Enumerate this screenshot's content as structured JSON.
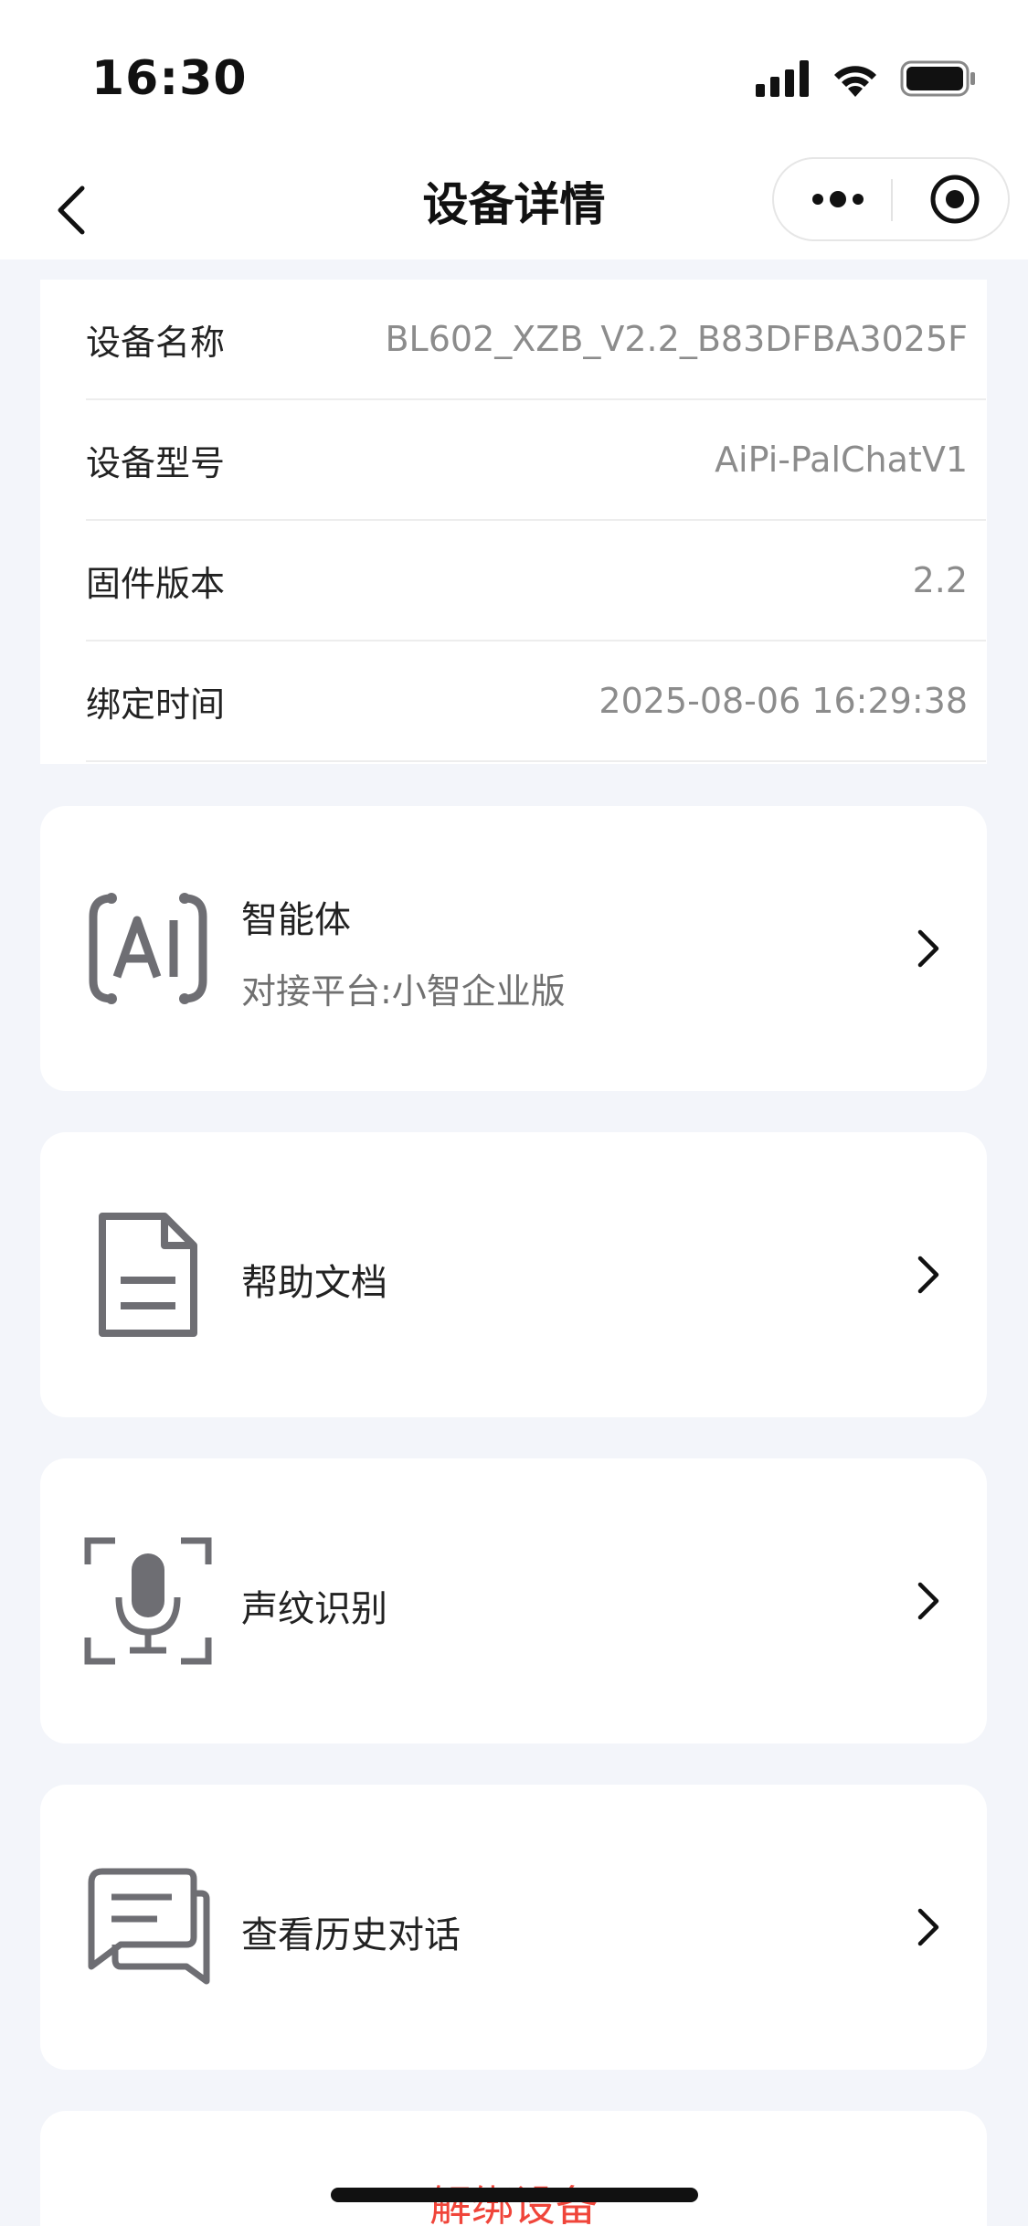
{
  "status_bar": {
    "time": "16:30"
  },
  "nav": {
    "title": "设备详情"
  },
  "device_info": [
    {
      "label": "设备名称",
      "value": "BL602_XZB_V2.2_B83DFBA3025F"
    },
    {
      "label": "设备型号",
      "value": "AiPi-PalChatV1"
    },
    {
      "label": "固件版本",
      "value": "2.2"
    },
    {
      "label": "绑定时间",
      "value": "2025-08-06 16:29:38"
    }
  ],
  "menu": [
    {
      "title": "智能体",
      "subtitle": "对接平台:小智企业版",
      "icon": "ai-agent-icon"
    },
    {
      "title": "帮助文档",
      "icon": "document-icon"
    },
    {
      "title": "声纹识别",
      "icon": "microphone-scan-icon"
    },
    {
      "title": "查看历史对话",
      "icon": "chat-bubbles-icon"
    }
  ],
  "unbind_label": "解绑设备",
  "colors": {
    "background": "#F3F5FA",
    "card": "#FFFFFF",
    "danger": "#F0453A",
    "icon_gray": "#6E6E73"
  }
}
